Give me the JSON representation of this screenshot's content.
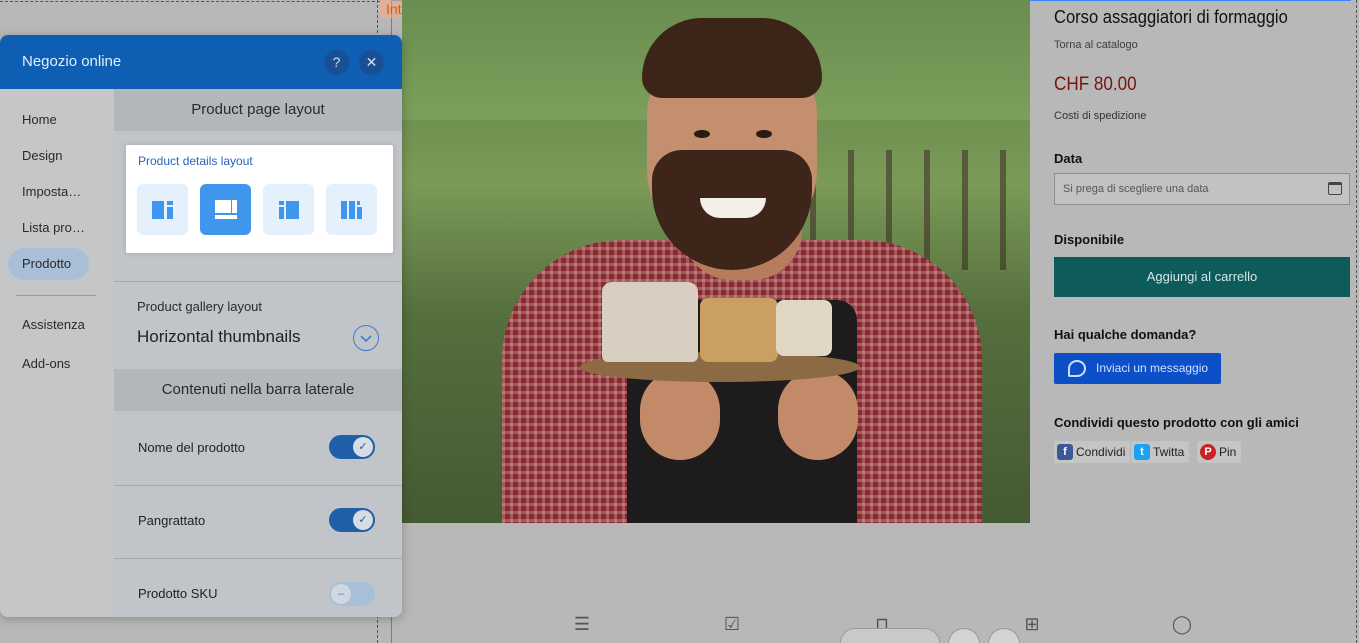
{
  "canvas": {
    "header_tag": "Intestazione"
  },
  "product": {
    "title": "Corso assaggiatori di formaggio",
    "back_link": "Torna al catalogo",
    "price": "CHF 80.00",
    "shipping": "Costi di spedizione",
    "date_label": "Data",
    "date_placeholder": "Si prega di scegliere una data",
    "availability": "Disponibile",
    "add_to_cart": "Aggiungi al carrello",
    "question_label": "Hai qualche domanda?",
    "message_button": "Inviaci un messaggio",
    "share_label": "Condividi questo prodotto con gli amici",
    "share_buttons": [
      {
        "label": "Condividi",
        "icon": "facebook-icon",
        "color": "#3b5998"
      },
      {
        "label": "Twitta",
        "icon": "twitter-icon",
        "color": "#1da1f2"
      },
      {
        "label": "Pin",
        "icon": "pinterest-icon",
        "color": "#cb2027"
      }
    ],
    "button_color": "#0d5b5b",
    "price_color": "#7a1212"
  },
  "panel": {
    "title": "Negozio online",
    "help_icon": "?",
    "close_icon": "✕",
    "accent_color": "#0e5fb3",
    "nav": [
      {
        "label": "Home",
        "active": false
      },
      {
        "label": "Design",
        "active": false
      },
      {
        "label": "Imposta…",
        "active": false
      },
      {
        "label": "Lista pro…",
        "active": false
      },
      {
        "label": "Prodotto",
        "active": true
      },
      {
        "label": "Assistenza",
        "active": false
      },
      {
        "label": "Add-ons",
        "active": false
      }
    ],
    "section_layout": "Product page layout",
    "details_layout_title": "Product details layout",
    "details_layout_options": [
      {
        "icon": "layout-left-image-icon",
        "selected": false
      },
      {
        "icon": "layout-top-image-icon",
        "selected": true
      },
      {
        "icon": "layout-center-image-icon",
        "selected": false
      },
      {
        "icon": "layout-columns-icon",
        "selected": false
      }
    ],
    "gallery_label": "Product gallery layout",
    "gallery_value": "Horizontal thumbnails",
    "section_sidebar": "Contenuti nella barra laterale",
    "toggles": [
      {
        "label": "Nome del prodotto",
        "on": true
      },
      {
        "label": "Pangrattato",
        "on": true
      },
      {
        "label": "Prodotto SKU",
        "on": false
      }
    ]
  }
}
